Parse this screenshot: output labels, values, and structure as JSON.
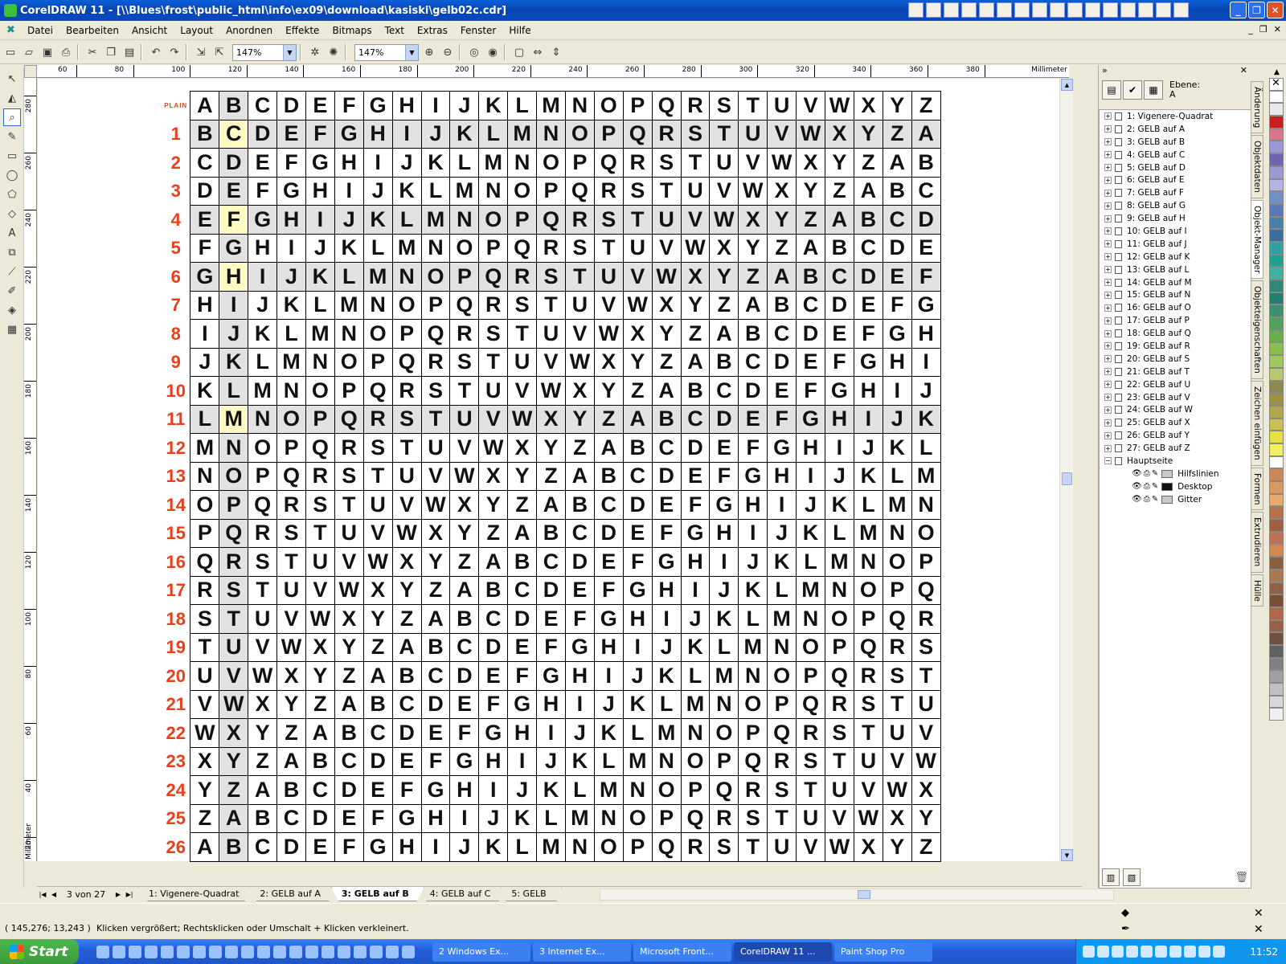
{
  "window": {
    "title": "CorelDRAW 11 - [\\\\Blues\\frost\\public_html\\info\\ex09\\download\\kasiski\\gelb02c.cdr]",
    "controls": [
      "_",
      "❐",
      "✕"
    ]
  },
  "menu": {
    "items": [
      "Datei",
      "Bearbeiten",
      "Ansicht",
      "Layout",
      "Anordnen",
      "Effekte",
      "Bitmaps",
      "Text",
      "Extras",
      "Fenster",
      "Hilfe"
    ],
    "mdi_controls": [
      "_",
      "❐",
      "✕"
    ]
  },
  "toolbar": {
    "zoom_value_1": "147%",
    "zoom_value_2": "147%"
  },
  "ruler": {
    "unit": "Millimeter",
    "h_ticks": [
      "60",
      "80",
      "100",
      "120",
      "140",
      "160",
      "180",
      "200",
      "220",
      "240",
      "260",
      "280",
      "300",
      "320",
      "340",
      "360",
      "380"
    ],
    "v_ticks": [
      "280",
      "260",
      "240",
      "220",
      "200",
      "180",
      "160",
      "140",
      "120",
      "100",
      "80",
      "60",
      "40",
      "20"
    ]
  },
  "vigenere": {
    "plain_label": "PLAIN",
    "alphabet": [
      "A",
      "B",
      "C",
      "D",
      "E",
      "F",
      "G",
      "H",
      "I",
      "J",
      "K",
      "L",
      "M",
      "N",
      "O",
      "P",
      "Q",
      "R",
      "S",
      "T",
      "U",
      "V",
      "W",
      "X",
      "Y",
      "Z"
    ],
    "row_labels": [
      "1",
      "2",
      "3",
      "4",
      "5",
      "6",
      "7",
      "8",
      "9",
      "10",
      "11",
      "12",
      "13",
      "14",
      "15",
      "16",
      "17",
      "18",
      "19",
      "20",
      "21",
      "22",
      "23",
      "24",
      "25",
      "26"
    ],
    "highlighted_rows": [
      1,
      4,
      6,
      11
    ],
    "highlighted_column": 1
  },
  "pages": {
    "counter": "3 von 27",
    "tabs": [
      "1: Vigenere-Quadrat",
      "2: GELB auf A",
      "3: GELB auf B",
      "4: GELB auf C",
      "5: GELB"
    ],
    "active_tab": "3: GELB auf B"
  },
  "docker": {
    "ebene_label": "Ebene:",
    "ebene_value": "A",
    "pages": [
      "1: Vigenere-Quadrat",
      "2: GELB auf A",
      "3: GELB auf B",
      "4: GELB auf C",
      "5: GELB auf D",
      "6: GELB auf E",
      "7: GELB auf F",
      "8: GELB auf G",
      "9: GELB auf H",
      "10: GELB auf I",
      "11: GELB auf J",
      "12: GELB auf K",
      "13: GELB auf L",
      "14: GELB auf M",
      "15: GELB auf N",
      "16: GELB auf O",
      "17: GELB auf P",
      "18: GELB auf Q",
      "19: GELB auf R",
      "20: GELB auf S",
      "21: GELB auf T",
      "22: GELB auf U",
      "23: GELB auf V",
      "24: GELB auf W",
      "25: GELB auf X",
      "26: GELB auf Y",
      "27: GELB auf Z"
    ],
    "master": "Hauptseite",
    "layers": [
      {
        "name": "Hilfslinien",
        "color": "#c8c8c8"
      },
      {
        "name": "Desktop",
        "color": "#111111"
      },
      {
        "name": "Gitter",
        "color": "#c8c8c8"
      }
    ],
    "side_tabs": [
      "Änderung",
      "Objektdaten",
      "Objekt-Manager",
      "Objekteigenschaften",
      "Zeichen einfügen",
      "Formen",
      "Extrudieren",
      "Hülle"
    ]
  },
  "palette": [
    "#ffffff",
    "#e8e8e8",
    "#c81e1e",
    "#d8748c",
    "#9898d8",
    "#6c64b0",
    "#9a9ad0",
    "#b4b4e4",
    "#7090c8",
    "#5878b8",
    "#4880a8",
    "#3870a0",
    "#30a0a0",
    "#20a090",
    "#40b0a0",
    "#308878",
    "#208070",
    "#3c9070",
    "#50a060",
    "#66b048",
    "#88c050",
    "#a0c860",
    "#b8c870",
    "#8a8a50",
    "#9a9048",
    "#b0a848",
    "#c8c050",
    "#e8e040",
    "#f0f060",
    "#ffffff",
    "#c88858",
    "#d89860",
    "#e8a868",
    "#b87048",
    "#a06040",
    "#c0704c",
    "#d08850",
    "#886040",
    "#a87850",
    "#906048",
    "#785038",
    "#b06848",
    "#986048",
    "#705040",
    "#606060",
    "#808080",
    "#a0a0a0",
    "#c0c0c0",
    "#d8d8d8",
    "#f0f0f0"
  ],
  "status": {
    "coords": "( 145,276; 13,243 )",
    "hint": "Klicken vergrößert; Rechtsklicken oder Umschalt + Klicken verkleinert."
  },
  "taskbar": {
    "start": "Start",
    "tasks": [
      "2 Windows Ex...",
      "3 Internet Ex...",
      "Microsoft Front...",
      "CorelDRAW 11 ...",
      "Paint Shop Pro"
    ],
    "active_task": "CorelDRAW 11 ...",
    "clock": "11:52"
  }
}
